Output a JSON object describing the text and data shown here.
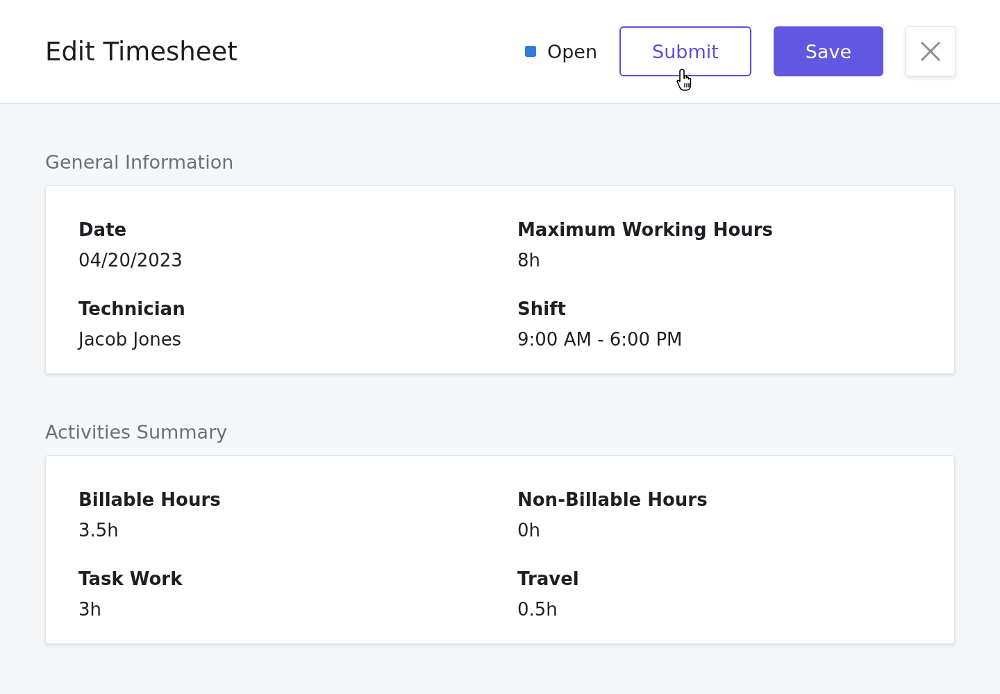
{
  "header": {
    "title": "Edit Timesheet",
    "status": {
      "label": "Open",
      "color": "#2f7bd6"
    },
    "buttons": [
      {
        "label": "Submit",
        "kind": "outline"
      },
      {
        "label": "Save",
        "kind": "primary"
      }
    ]
  },
  "sections": [
    {
      "title": "General Information",
      "fields": [
        {
          "label": "Date",
          "value": "04/20/2023"
        },
        {
          "label": "Maximum Working Hours",
          "value": "8h"
        },
        {
          "label": "Technician",
          "value": "Jacob Jones"
        },
        {
          "label": "Shift",
          "value": "9:00 AM - 6:00 PM"
        }
      ]
    },
    {
      "title": "Activities Summary",
      "fields": [
        {
          "label": "Billable Hours",
          "value": "3.5h"
        },
        {
          "label": "Non-Billable Hours",
          "value": "0h"
        },
        {
          "label": "Task Work",
          "value": "3h"
        },
        {
          "label": "Travel",
          "value": "0.5h"
        }
      ]
    }
  ]
}
